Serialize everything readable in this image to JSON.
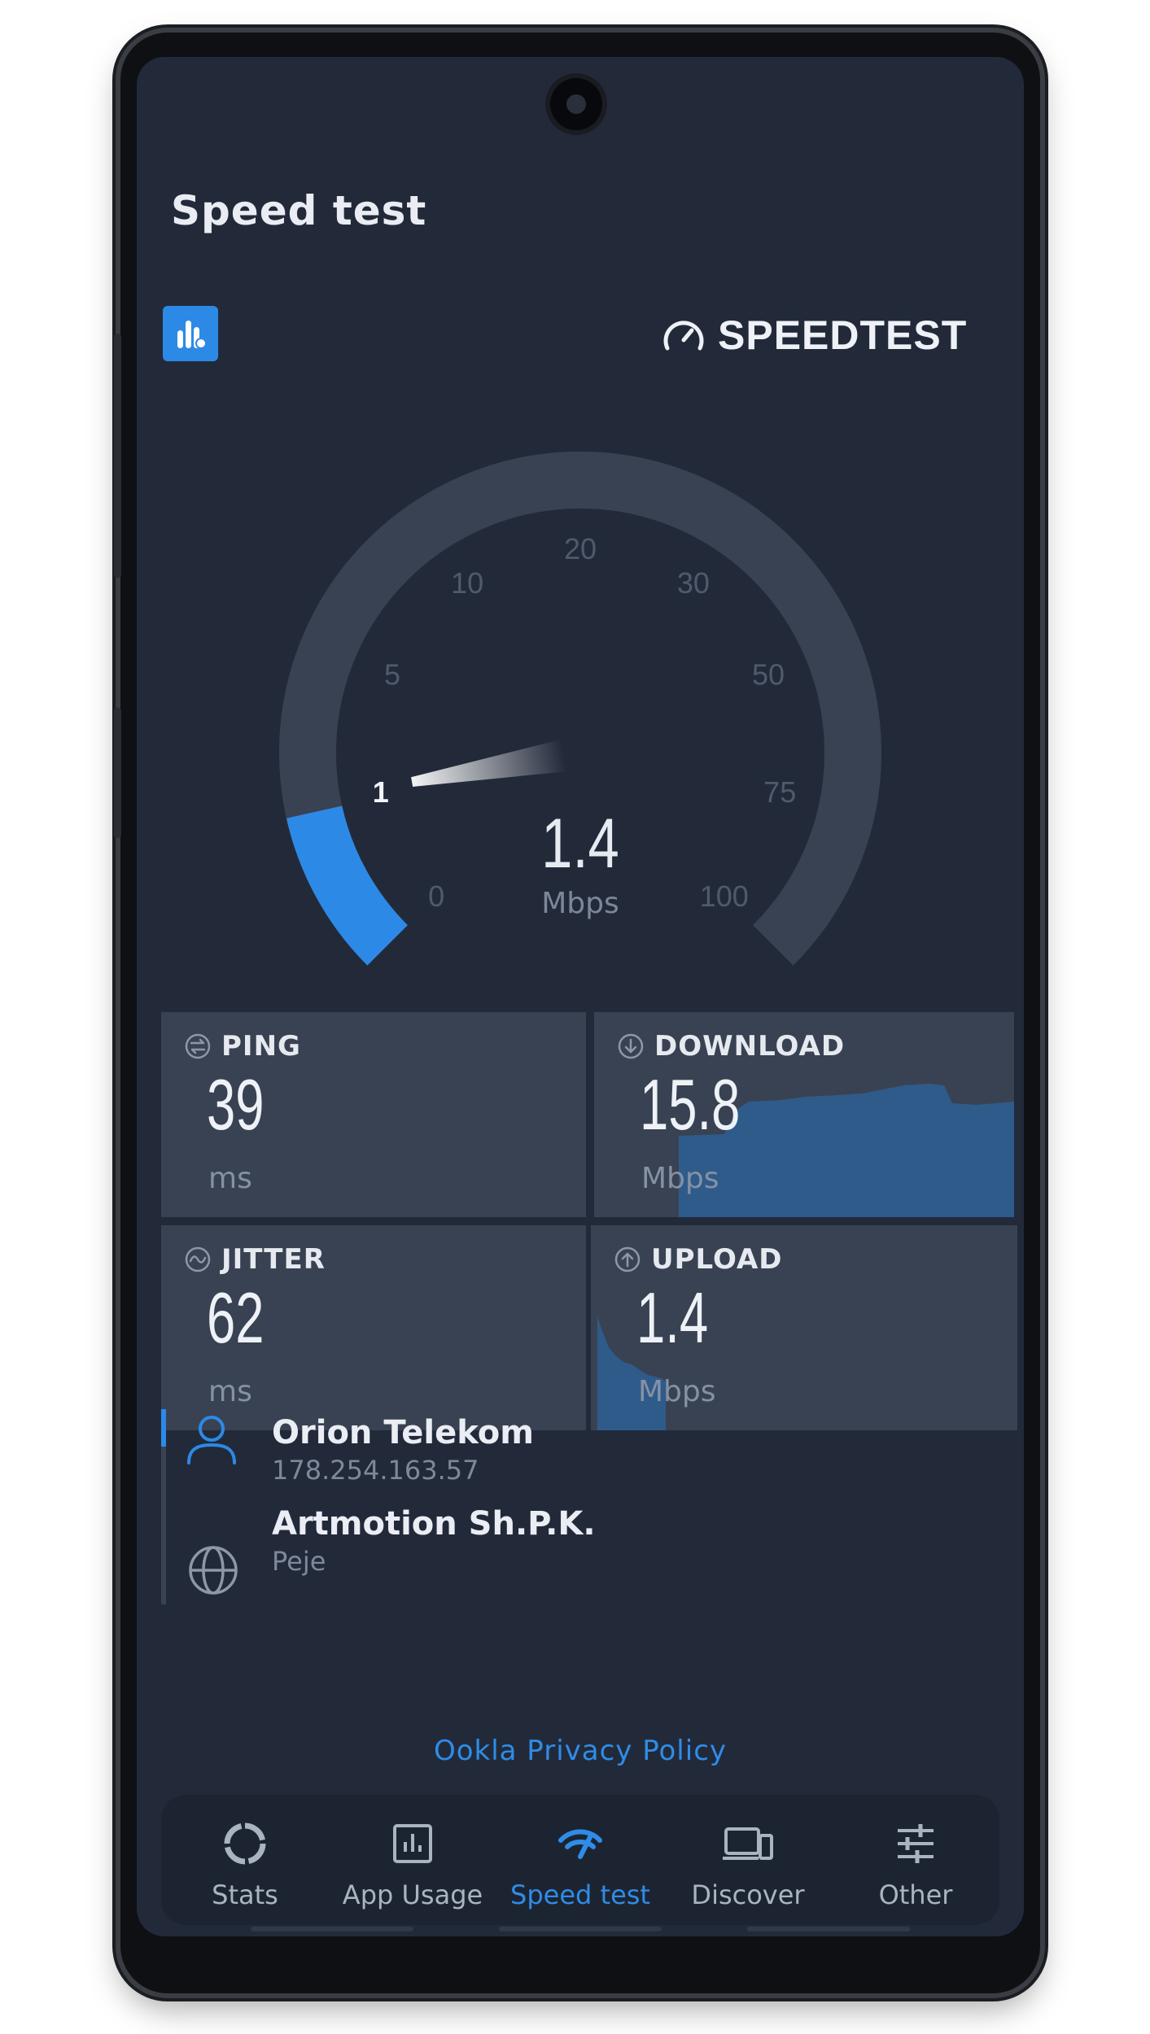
{
  "header": {
    "title": "Speed test"
  },
  "brand": {
    "name": "SPEEDTEST"
  },
  "gauge": {
    "ticks": [
      "0",
      "1",
      "5",
      "10",
      "20",
      "30",
      "50",
      "75",
      "100"
    ],
    "active_tick": "1",
    "value": "1.4",
    "unit": "Mbps",
    "fill_fraction": 0.12
  },
  "metrics": {
    "ping": {
      "label": "PING",
      "value": "39",
      "unit": "ms"
    },
    "download": {
      "label": "DOWNLOAD",
      "value": "15.8",
      "unit": "Mbps"
    },
    "jitter": {
      "label": "JITTER",
      "value": "62",
      "unit": "ms"
    },
    "upload": {
      "label": "UPLOAD",
      "value": "1.4",
      "unit": "Mbps"
    }
  },
  "connection": {
    "provider": "Orion Telekom",
    "ip": "178.254.163.57",
    "server": "Artmotion Sh.P.K.",
    "location": "Peje"
  },
  "privacy_link": "Ookla Privacy Policy",
  "nav": {
    "items": [
      {
        "label": "Stats",
        "icon": "stats-ring-icon"
      },
      {
        "label": "App Usage",
        "icon": "bar-chart-icon"
      },
      {
        "label": "Speed test",
        "icon": "speedometer-icon"
      },
      {
        "label": "Discover",
        "icon": "devices-icon"
      },
      {
        "label": "Other",
        "icon": "sliders-icon"
      }
    ],
    "active": "Speed test"
  },
  "colors": {
    "accent": "#2d89e6",
    "background": "#222a3a",
    "card": "#394252",
    "graph": "#2f5b8a"
  }
}
